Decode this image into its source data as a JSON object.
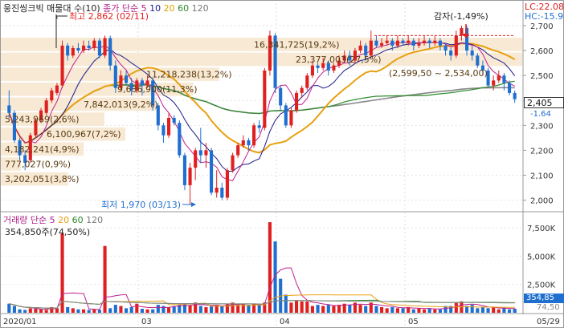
{
  "chart_data": [
    {
      "type": "candlestick",
      "title_parts": [
        "웅진씽크빅",
        "매물대 수(10)",
        "종가 단순",
        "5",
        "10",
        "20",
        "60",
        "120"
      ],
      "title_colors": [
        "#222222",
        "#222222",
        "#b0208a",
        "#b0208a",
        "#1a1a8c",
        "#e0a000",
        "#2a8a2a",
        "#777777"
      ],
      "y_ticks": [
        "2,700",
        "2,600",
        "2,500",
        "2,400",
        "2,300",
        "2,200",
        "2,100",
        "2,000"
      ],
      "ylim": [
        1960,
        2790
      ],
      "x_ticks": [
        "2020/01",
        "03",
        "04",
        "05",
        "05/29"
      ],
      "corner_labels": {
        "lc": "LC:22.08",
        "hc": "HC:-15.9"
      },
      "last_price": "2,405",
      "last_change": "-1.64",
      "colors": {
        "up": "#e02020",
        "down": "#1f6fd0",
        "band": "#f6e5cc",
        "ma5": "#c02090",
        "ma10": "#1a1a8c",
        "ma20": "#e8a010",
        "ma60": "#2a8a2a",
        "ma120": "#888888"
      },
      "volume_profile": [
        {
          "label": "16,341,725(19,2%)",
          "low": 2595,
          "high": 2655,
          "frac": 1.0
        },
        {
          "label": "23,377,003(27,5%)",
          "low": 2535,
          "high": 2595,
          "frac": 1.0
        },
        {
          "label": "11,218,238(13,2%)",
          "low": 2475,
          "high": 2535,
          "frac": 0.42
        },
        {
          "label": "9,636,900(11,3%)",
          "low": 2415,
          "high": 2475,
          "frac": 0.37
        },
        {
          "label": "7,842,013(9,2%)",
          "low": 2355,
          "high": 2415,
          "frac": 0.3
        },
        {
          "label": "5,243,969(2,6%)",
          "low": 2295,
          "high": 2355,
          "frac": 0.2
        },
        {
          "label": "6,100,967(7,2%)",
          "low": 2235,
          "high": 2295,
          "frac": 0.24
        },
        {
          "label": "4,182,241(4,9%)",
          "low": 2175,
          "high": 2235,
          "frac": 0.16
        },
        {
          "label": "777,027(0,9%)",
          "low": 2115,
          "high": 2175,
          "frac": 0.04
        },
        {
          "label": "3,202,051(3,8%)",
          "low": 2055,
          "high": 2115,
          "frac": 0.13
        }
      ],
      "annotations": {
        "high": "최고 2,862 (02/11)",
        "low": "최저 1,970 (03/13)",
        "capital_reduction": "감자(-1,49%)",
        "range": "(2,599,50 ~ 2,534,00)"
      },
      "candles": [
        [
          2380,
          2350,
          2440,
          2330
        ],
        [
          2350,
          2240,
          2360,
          2230
        ],
        [
          2240,
          2180,
          2250,
          2160
        ],
        [
          2180,
          2150,
          2200,
          2120
        ],
        [
          2160,
          2260,
          2270,
          2150
        ],
        [
          2260,
          2320,
          2330,
          2250
        ],
        [
          2320,
          2360,
          2370,
          2310
        ],
        [
          2350,
          2400,
          2410,
          2340
        ],
        [
          2400,
          2440,
          2450,
          2390
        ],
        [
          2430,
          2460,
          2470,
          2420
        ],
        [
          2460,
          2620,
          2640,
          2450
        ],
        [
          2620,
          2580,
          2630,
          2560
        ],
        [
          2580,
          2610,
          2620,
          2570
        ],
        [
          2610,
          2600,
          2630,
          2590
        ],
        [
          2600,
          2620,
          2640,
          2590
        ],
        [
          2620,
          2610,
          2640,
          2600
        ],
        [
          2610,
          2640,
          2650,
          2600
        ],
        [
          2640,
          2580,
          2650,
          2570
        ],
        [
          2580,
          2650,
          2660,
          2570
        ],
        [
          2650,
          2540,
          2660,
          2520
        ],
        [
          2540,
          2450,
          2560,
          2430
        ],
        [
          2450,
          2500,
          2520,
          2440
        ],
        [
          2500,
          2470,
          2520,
          2460
        ],
        [
          2470,
          2440,
          2490,
          2420
        ],
        [
          2440,
          2480,
          2490,
          2430
        ],
        [
          2480,
          2460,
          2490,
          2420
        ],
        [
          2460,
          2480,
          2500,
          2450
        ],
        [
          2480,
          2380,
          2490,
          2360
        ],
        [
          2380,
          2300,
          2390,
          2280
        ],
        [
          2300,
          2260,
          2310,
          2230
        ],
        [
          2260,
          2330,
          2350,
          2250
        ],
        [
          2330,
          2310,
          2340,
          2300
        ],
        [
          2310,
          2180,
          2320,
          2170
        ],
        [
          2180,
          2060,
          2190,
          2040
        ],
        [
          2060,
          2130,
          2150,
          1980
        ],
        [
          2130,
          2200,
          2210,
          2080
        ],
        [
          2200,
          2180,
          2290,
          2150
        ],
        [
          2180,
          2200,
          2230,
          2130
        ],
        [
          2200,
          2030,
          2210,
          2020
        ],
        [
          2030,
          2050,
          2120,
          2010
        ],
        [
          2050,
          2010,
          2070,
          2000
        ],
        [
          2010,
          2120,
          2130,
          2000
        ],
        [
          2120,
          2180,
          2190,
          2110
        ],
        [
          2180,
          2220,
          2230,
          2170
        ],
        [
          2220,
          2240,
          2260,
          2210
        ],
        [
          2240,
          2220,
          2250,
          2200
        ],
        [
          2220,
          2300,
          2310,
          2210
        ],
        [
          2300,
          2290,
          2320,
          2270
        ],
        [
          2290,
          2520,
          2530,
          2280
        ],
        [
          2520,
          2660,
          2680,
          2500
        ],
        [
          2660,
          2450,
          2670,
          2430
        ],
        [
          2450,
          2380,
          2460,
          2360
        ],
        [
          2380,
          2300,
          2390,
          2290
        ],
        [
          2300,
          2360,
          2370,
          2290
        ],
        [
          2360,
          2430,
          2440,
          2350
        ],
        [
          2430,
          2450,
          2460,
          2410
        ],
        [
          2450,
          2500,
          2510,
          2440
        ],
        [
          2500,
          2540,
          2560,
          2490
        ],
        [
          2540,
          2530,
          2550,
          2510
        ],
        [
          2530,
          2550,
          2570,
          2520
        ],
        [
          2550,
          2520,
          2560,
          2500
        ],
        [
          2520,
          2540,
          2550,
          2510
        ],
        [
          2540,
          2560,
          2580,
          2530
        ],
        [
          2560,
          2580,
          2600,
          2550
        ],
        [
          2580,
          2560,
          2600,
          2540
        ],
        [
          2560,
          2600,
          2610,
          2550
        ],
        [
          2600,
          2620,
          2640,
          2590
        ],
        [
          2620,
          2580,
          2630,
          2560
        ],
        [
          2580,
          2640,
          2680,
          2570
        ],
        [
          2640,
          2620,
          2660,
          2610
        ],
        [
          2620,
          2630,
          2650,
          2610
        ],
        [
          2630,
          2640,
          2660,
          2620
        ],
        [
          2640,
          2620,
          2650,
          2600
        ],
        [
          2620,
          2640,
          2660,
          2610
        ],
        [
          2640,
          2630,
          2650,
          2620
        ],
        [
          2630,
          2640,
          2660,
          2620
        ],
        [
          2640,
          2620,
          2650,
          2600
        ],
        [
          2620,
          2630,
          2650,
          2610
        ],
        [
          2630,
          2640,
          2660,
          2620
        ],
        [
          2640,
          2630,
          2650,
          2610
        ],
        [
          2630,
          2640,
          2660,
          2620
        ],
        [
          2640,
          2620,
          2650,
          2600
        ],
        [
          2620,
          2600,
          2630,
          2580
        ],
        [
          2600,
          2580,
          2610,
          2560
        ],
        [
          2580,
          2660,
          2680,
          2570
        ],
        [
          2660,
          2690,
          2700,
          2640
        ],
        [
          2690,
          2600,
          2700,
          2580
        ],
        [
          2600,
          2580,
          2620,
          2560
        ],
        [
          2580,
          2540,
          2590,
          2530
        ],
        [
          2540,
          2520,
          2560,
          2500
        ],
        [
          2520,
          2460,
          2530,
          2450
        ],
        [
          2460,
          2480,
          2500,
          2440
        ],
        [
          2480,
          2500,
          2520,
          2470
        ],
        [
          2500,
          2470,
          2510,
          2440
        ],
        [
          2470,
          2430,
          2480,
          2420
        ],
        [
          2430,
          2405,
          2440,
          2390
        ]
      ],
      "volume": {
        "label_parts": [
          "거래량",
          "단순",
          "5",
          "20",
          "60",
          "120"
        ],
        "label_colors": [
          "#b0208a",
          "#b0208a",
          "#b0208a",
          "#e8a010",
          "#2a8a2a",
          "#777777"
        ],
        "current": "354,850주(74,50%)",
        "y_ticks": [
          "7,500K",
          "5,000K",
          "2,500K"
        ],
        "ylim": [
          0,
          8500
        ],
        "last_value": "354,85",
        "last_pct": "74,50",
        "bars": [
          800,
          600,
          300,
          250,
          400,
          350,
          300,
          250,
          500,
          400,
          7000,
          500,
          400,
          300,
          300,
          250,
          300,
          250,
          5900,
          400,
          700,
          600,
          400,
          500,
          800,
          350,
          300,
          300,
          700,
          600,
          500,
          600,
          700,
          800,
          650,
          900,
          600,
          500,
          600,
          700,
          600,
          800,
          900,
          700,
          800,
          700,
          800,
          700,
          900,
          8000,
          6300,
          3000,
          1600,
          900,
          1100,
          1000,
          1000,
          600,
          700,
          600,
          700,
          600,
          700,
          800,
          700,
          900,
          700,
          600,
          900,
          600,
          500,
          400,
          500,
          400,
          400,
          500,
          300,
          400,
          300,
          400,
          300,
          300,
          600,
          600,
          900,
          1000,
          600,
          700,
          400,
          500,
          400,
          500,
          300,
          400,
          300,
          350,
          355
        ]
      }
    }
  ]
}
